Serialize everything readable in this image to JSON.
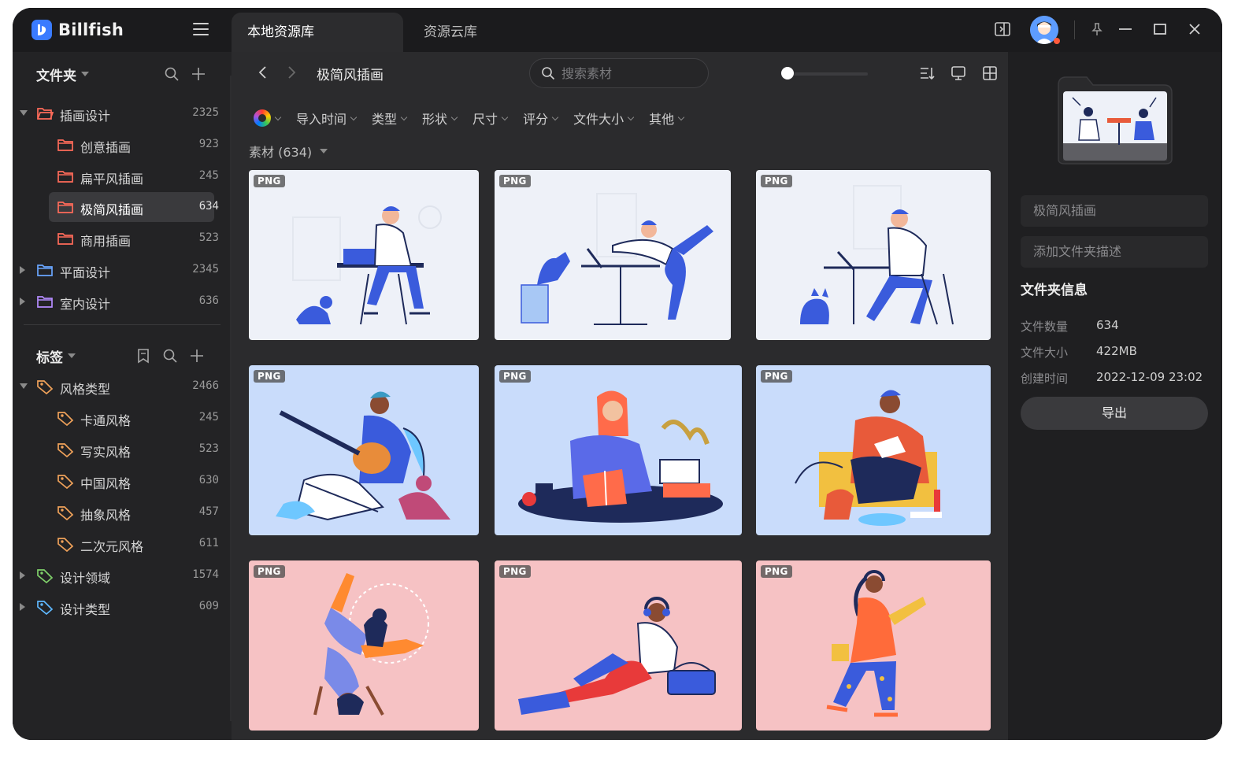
{
  "app": {
    "name": "Billfish"
  },
  "tabs": [
    {
      "label": "本地资源库",
      "active": true
    },
    {
      "label": "资源云库",
      "active": false
    }
  ],
  "sidebar": {
    "folders_header": "文件夹",
    "folders": [
      {
        "label": "插画设计",
        "count": "2325",
        "expanded": true,
        "level": 0
      },
      {
        "label": "创意插画",
        "count": "923",
        "level": 1
      },
      {
        "label": "扁平风插画",
        "count": "245",
        "level": 1
      },
      {
        "label": "极简风插画",
        "count": "634",
        "level": 1,
        "selected": true
      },
      {
        "label": "商用插画",
        "count": "523",
        "level": 1
      },
      {
        "label": "平面设计",
        "count": "2345",
        "expanded": false,
        "level": 0
      },
      {
        "label": "室内设计",
        "count": "636",
        "expanded": false,
        "level": 0
      }
    ],
    "tags_header": "标签",
    "tags": [
      {
        "label": "风格类型",
        "count": "2466",
        "expanded": true,
        "level": 0,
        "color": "#f0a25a"
      },
      {
        "label": "卡通风格",
        "count": "245",
        "level": 1,
        "color": "#f0a25a"
      },
      {
        "label": "写实风格",
        "count": "523",
        "level": 1,
        "color": "#f0a25a"
      },
      {
        "label": "中国风格",
        "count": "630",
        "level": 1,
        "color": "#f0a25a"
      },
      {
        "label": "抽象风格",
        "count": "457",
        "level": 1,
        "color": "#f0a25a"
      },
      {
        "label": "二次元风格",
        "count": "611",
        "level": 1,
        "color": "#f0a25a"
      },
      {
        "label": "设计领域",
        "count": "1574",
        "expanded": false,
        "level": 0,
        "color": "#7fd06a"
      },
      {
        "label": "设计类型",
        "count": "609",
        "expanded": false,
        "level": 0,
        "color": "#5fb8ff"
      }
    ]
  },
  "main": {
    "breadcrumb": "极简风插画",
    "search_placeholder": "搜索素材",
    "filters": [
      "导入时间",
      "类型",
      "形状",
      "尺寸",
      "评分",
      "文件大小",
      "其他"
    ],
    "count_label": "素材 (634)",
    "cards": [
      {
        "badge": "PNG",
        "bg": "#eef1f8"
      },
      {
        "badge": "PNG",
        "bg": "#eef1f8"
      },
      {
        "badge": "PNG",
        "bg": "#eef1f8"
      },
      {
        "badge": "PNG",
        "bg": "#c9dcfb"
      },
      {
        "badge": "PNG",
        "bg": "#c9dcfb"
      },
      {
        "badge": "PNG",
        "bg": "#c9dcfb"
      },
      {
        "badge": "PNG",
        "bg": "#f6c2c4"
      },
      {
        "badge": "PNG",
        "bg": "#f6c2c4"
      },
      {
        "badge": "PNG",
        "bg": "#f6c2c4"
      }
    ]
  },
  "panel": {
    "name_value": "极简风插画",
    "desc_placeholder": "添加文件夹描述",
    "info_title": "文件夹信息",
    "info": [
      {
        "label": "文件数量",
        "value": "634"
      },
      {
        "label": "文件大小",
        "value": "422MB"
      },
      {
        "label": "创建时间",
        "value": "2022-12-09 23:02"
      }
    ],
    "export_label": "导出"
  },
  "colors": {
    "accent": "#3a7bff",
    "folder_icon": "#ff6b5a",
    "plain_folder": "#9b7cff"
  }
}
